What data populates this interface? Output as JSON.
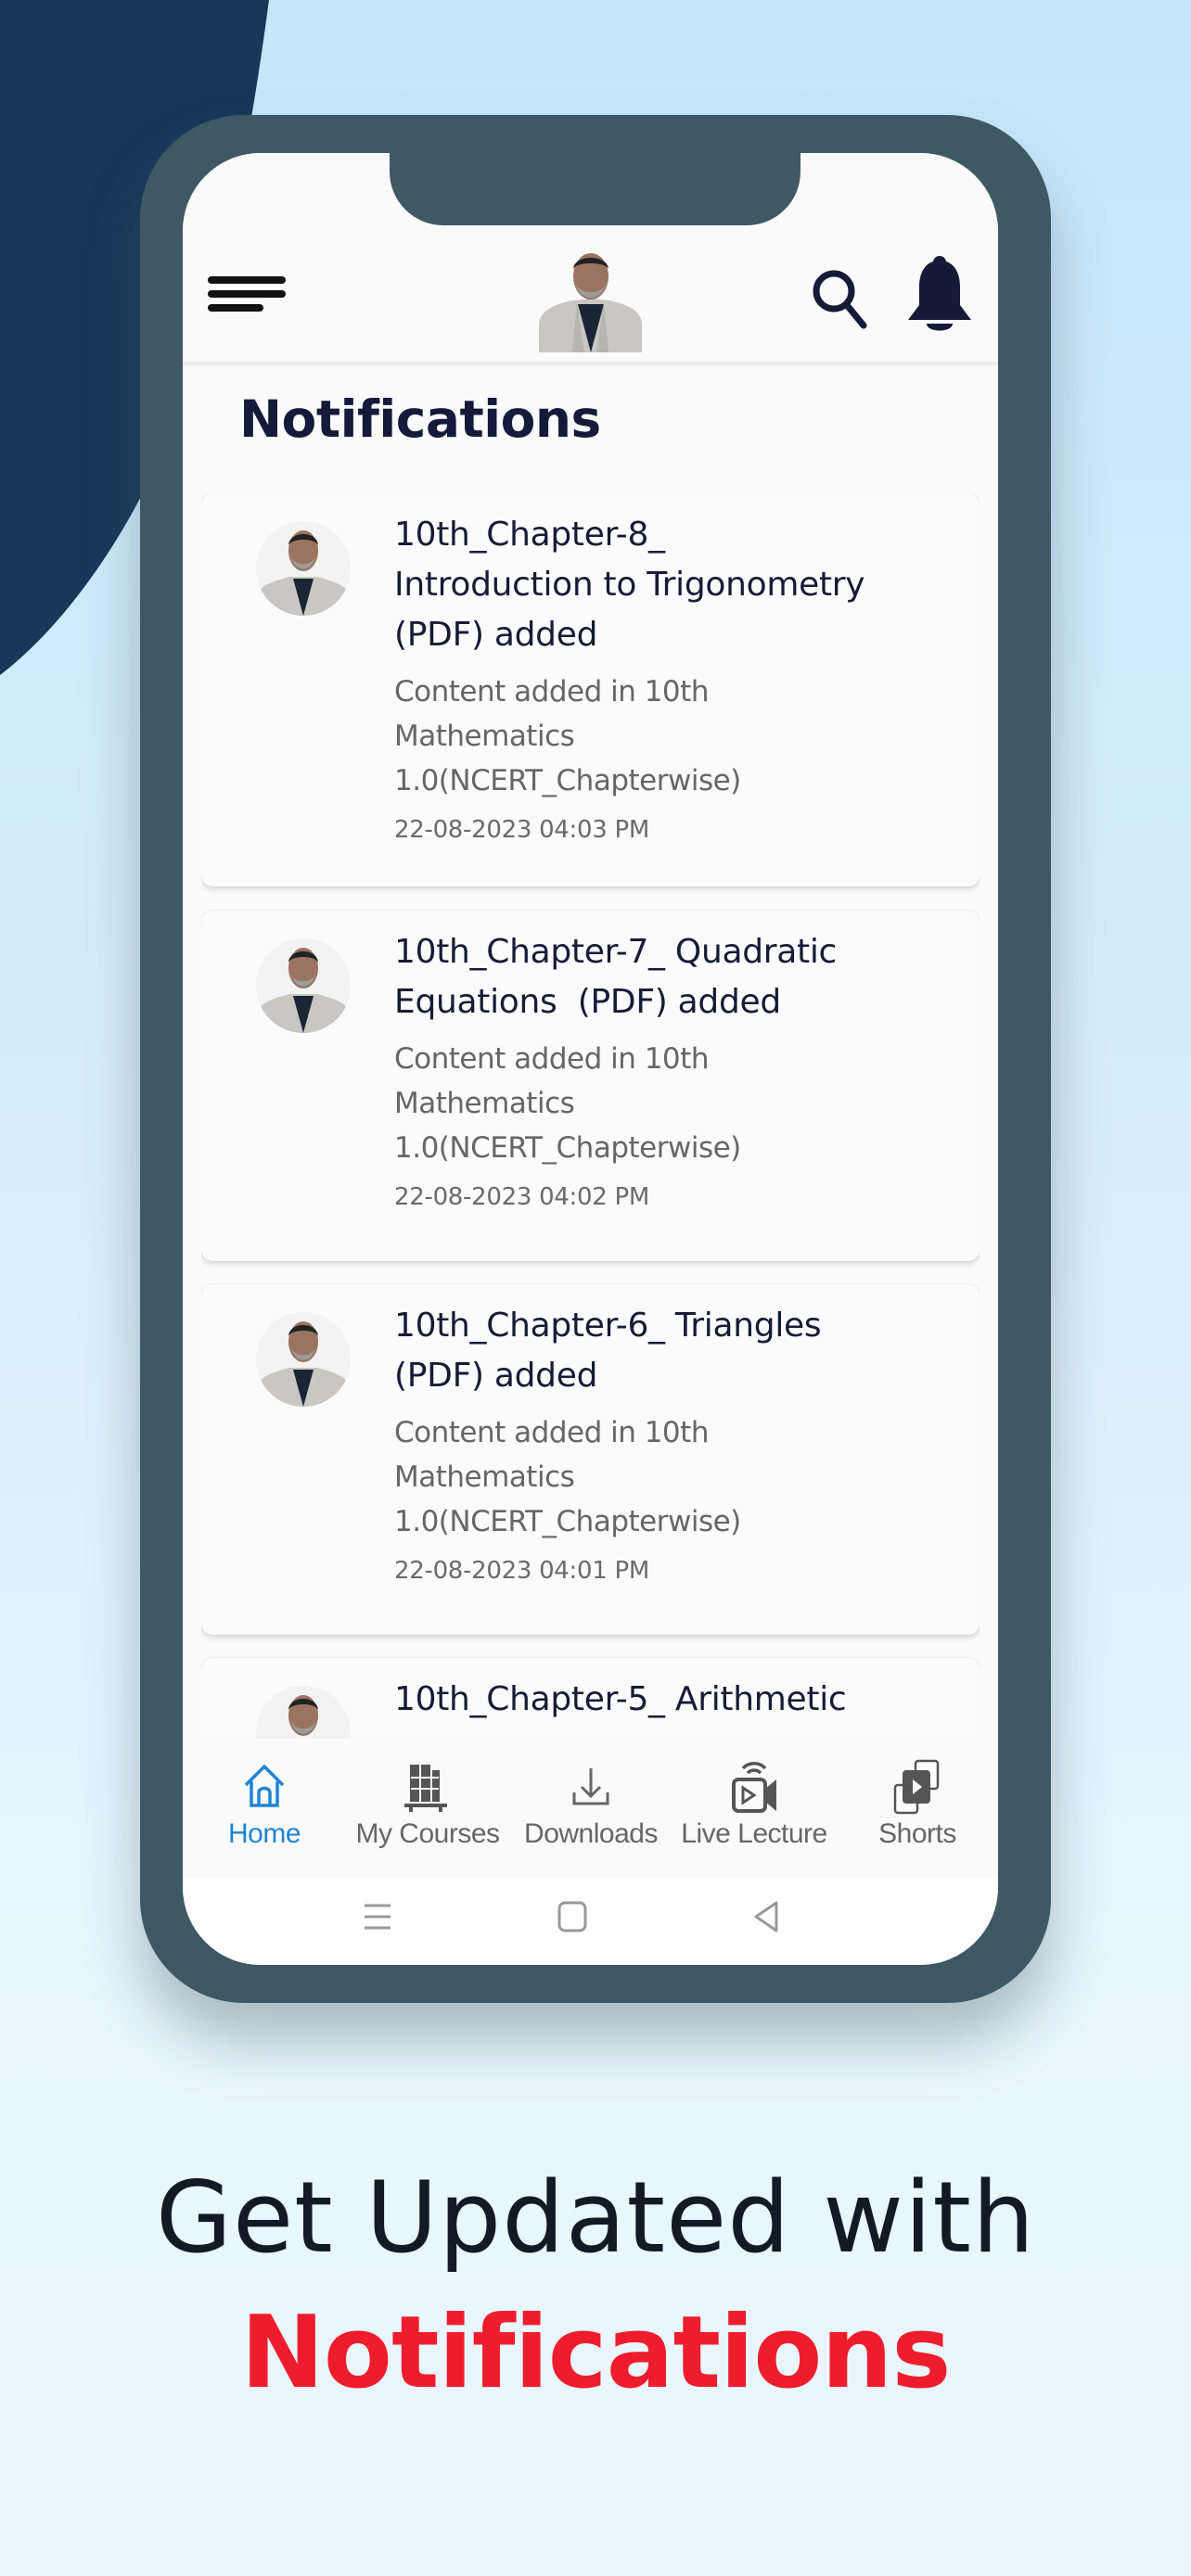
{
  "colors": {
    "frame": "#3f5964",
    "navy_shape": "#18385a",
    "accent_blue": "#1f84d6",
    "title_ink": "#141a3a",
    "tagline_red": "#ee1d2e"
  },
  "header": {
    "menu_icon": "menu-icon",
    "logo": "instructor-logo",
    "search_icon": "search-icon",
    "bell_icon": "bell-icon"
  },
  "page": {
    "title": "Notifications"
  },
  "notifications": [
    {
      "title": "10th_Chapter-8_ Introduction to Trigonometry (PDF) added",
      "title_lines": [
        "10th_Chapter-8_",
        "Introduction to Trigonometry",
        "(PDF) added"
      ],
      "subtitle": "Content added in 10th Mathematics 1.0(NCERT_Chapterwise)",
      "date": "22-08-2023 04:03 PM"
    },
    {
      "title": "10th_Chapter-7_ Quadratic Equations  (PDF) added",
      "title_lines": [
        "10th_Chapter-7_ Quadratic",
        "Equations  (PDF) added"
      ],
      "subtitle": "Content added in 10th Mathematics 1.0(NCERT_Chapterwise)",
      "date": "22-08-2023 04:02 PM"
    },
    {
      "title": "10th_Chapter-6_ Triangles (PDF) added",
      "title_lines": [
        "10th_Chapter-6_ Triangles",
        "(PDF) added"
      ],
      "subtitle": "Content added in 10th Mathematics 1.0(NCERT_Chapterwise)",
      "date": "22-08-2023 04:01 PM"
    },
    {
      "title": "10th_Chapter-5_ Arithmetic",
      "title_lines": [
        "10th_Chapter-5_ Arithmetic"
      ],
      "subtitle": "",
      "date": ""
    }
  ],
  "bottom_nav": [
    {
      "label": "Home",
      "icon": "home-icon",
      "active": true
    },
    {
      "label": "My Courses",
      "icon": "books-icon",
      "active": false
    },
    {
      "label": "Downloads",
      "icon": "download-icon",
      "active": false
    },
    {
      "label": "Live Lecture",
      "icon": "live-video-icon",
      "active": false
    },
    {
      "label": "Shorts",
      "icon": "shorts-icon",
      "active": false
    }
  ],
  "system_nav": [
    "recents-button",
    "home-button",
    "back-button"
  ],
  "tagline": {
    "line1": "Get Updated with",
    "line2": "Notifications"
  }
}
